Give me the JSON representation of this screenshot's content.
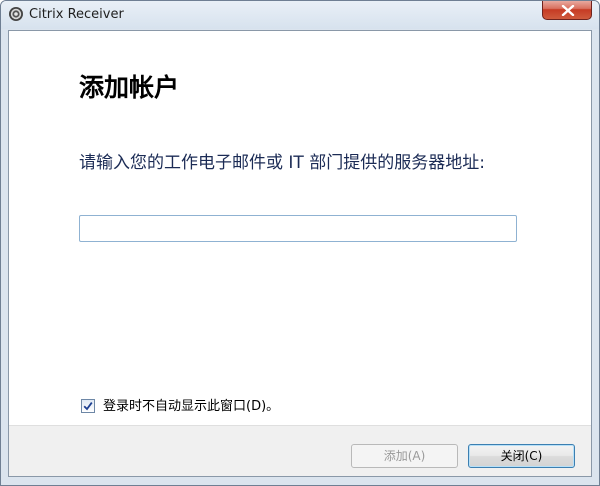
{
  "window": {
    "title": "Citrix Receiver"
  },
  "icons": {
    "app": "citrix-receiver-icon",
    "close": "close-x-icon",
    "check": "checkmark-icon"
  },
  "dialog": {
    "heading": "添加帐户",
    "instruction": "请输入您的工作电子邮件或 IT 部门提供的服务器地址:",
    "address_input": {
      "value": "",
      "placeholder": ""
    },
    "checkbox": {
      "label": "登录时不自动显示此窗口(D)。",
      "checked": true
    }
  },
  "buttons": {
    "add_label": "添加(A)",
    "add_enabled": false,
    "close_label": "关闭(C)"
  },
  "colors": {
    "titlebar": "#dbe4ee",
    "close_button_red": "#c63b24",
    "instruction_text": "#1b2b55",
    "input_border": "#8fb2d2"
  }
}
